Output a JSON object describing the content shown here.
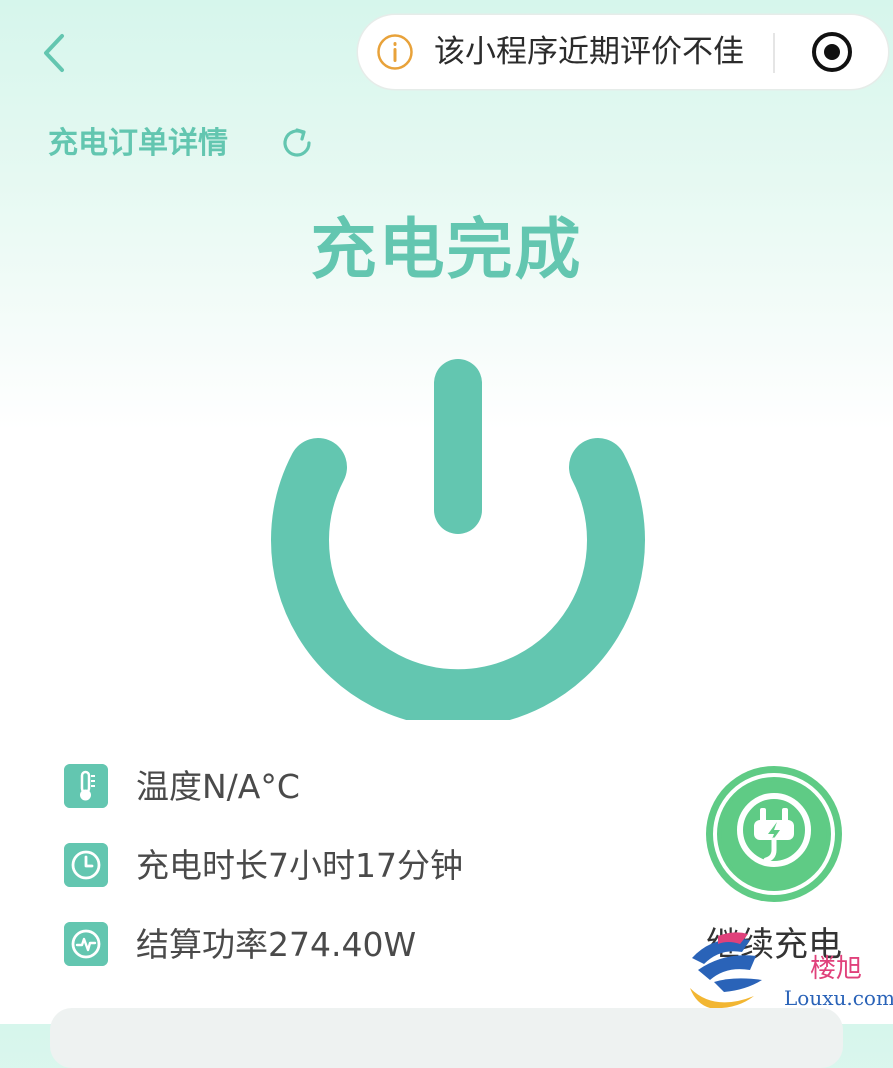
{
  "nav": {
    "back_icon": "chevron-left-icon",
    "notice_icon": "info-circle-icon",
    "notice_text": "该小程序近期评价不佳",
    "record_icon": "record-icon"
  },
  "header": {
    "title": "充电订单详情",
    "refresh_icon": "refresh-icon"
  },
  "status": {
    "text": "充电完成",
    "icon": "power-icon"
  },
  "info": [
    {
      "icon": "thermometer-icon",
      "text": "温度N/A°C"
    },
    {
      "icon": "clock-icon",
      "text": "充电时长7小时17分钟"
    },
    {
      "icon": "power-meter-icon",
      "text": "结算功率274.40W"
    }
  ],
  "continue": {
    "icon": "plug-icon",
    "label": "继续充电"
  },
  "watermark": {
    "brand": "楼旭",
    "domain": "Louxu.com"
  },
  "colors": {
    "accent": "#63c6b0",
    "continue_ring": "#5fcb85",
    "warning": "#e8a23a"
  }
}
